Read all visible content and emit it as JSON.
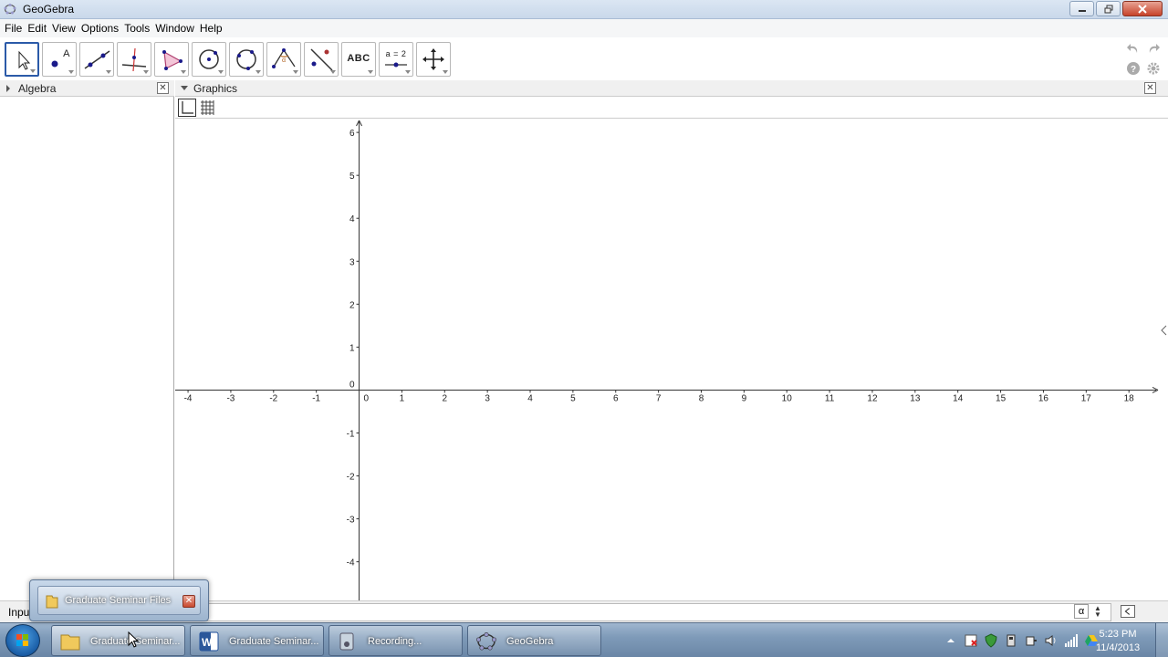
{
  "window": {
    "title": "GeoGebra"
  },
  "menu": {
    "items": [
      "File",
      "Edit",
      "View",
      "Options",
      "Tools",
      "Window",
      "Help"
    ]
  },
  "toolbar": {
    "tools": [
      {
        "name": "move-tool",
        "icon": "cursor-arrow-icon"
      },
      {
        "name": "new-point-tool",
        "icon": "point-icon",
        "text": "A"
      },
      {
        "name": "line-tool",
        "icon": "line-through-points-icon"
      },
      {
        "name": "perpendicular-line-tool",
        "icon": "perpendicular-icon"
      },
      {
        "name": "polygon-tool",
        "icon": "polygon-icon"
      },
      {
        "name": "circle-tool",
        "icon": "circle-center-point-icon"
      },
      {
        "name": "circle-three-points-tool",
        "icon": "circle-three-points-icon"
      },
      {
        "name": "angle-tool",
        "icon": "angle-icon"
      },
      {
        "name": "reflect-tool",
        "icon": "reflect-icon"
      },
      {
        "name": "text-tool",
        "icon": "text-icon",
        "text": "ABC"
      },
      {
        "name": "slider-tool",
        "icon": "slider-icon",
        "text": "a = 2"
      },
      {
        "name": "move-graphics-tool",
        "icon": "move-arrows-icon"
      }
    ],
    "active_tool_index": 0
  },
  "algebra_panel": {
    "title": "Algebra"
  },
  "graphics_panel": {
    "title": "Graphics"
  },
  "axes": {
    "x_ticks": [
      "-4",
      "-3",
      "-2",
      "-1",
      "0",
      "1",
      "2",
      "3",
      "4",
      "5",
      "6",
      "7",
      "8",
      "9",
      "10",
      "11",
      "12",
      "13",
      "14",
      "15",
      "16",
      "17",
      "18"
    ],
    "y_ticks": [
      "6",
      "5",
      "4",
      "3",
      "2",
      "1",
      "0",
      "-1",
      "-2",
      "-3",
      "-4"
    ],
    "x_range": [
      -4.3,
      18.7
    ],
    "y_range": [
      -4.9,
      6.3
    ]
  },
  "input_bar": {
    "label": "Input:",
    "alpha": "α"
  },
  "taskbar": {
    "buttons": [
      {
        "label": "Graduate Seminar...",
        "icon": "folder-icon",
        "active": true
      },
      {
        "label": "Graduate Seminar...",
        "icon": "word-icon",
        "active": false
      },
      {
        "label": "Recording...",
        "icon": "recorder-icon",
        "active": false
      },
      {
        "label": "GeoGebra",
        "icon": "geogebra-icon",
        "active": false
      }
    ],
    "clock_time": "5:23 PM",
    "clock_date": "11/4/2013"
  },
  "thumbnail_popup": {
    "label": "Graduate Seminar Files"
  },
  "colors": {
    "active_tool_border": "#2b5aa8",
    "point_blue": "#1a1a8a",
    "axis": "#333333"
  }
}
